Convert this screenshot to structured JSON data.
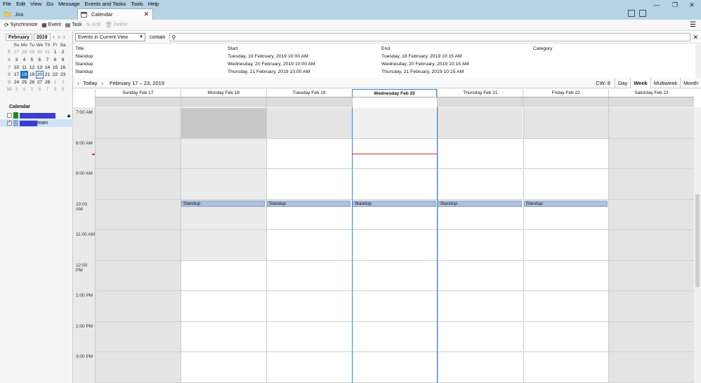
{
  "menu": [
    "File",
    "Edit",
    "View",
    "Go",
    "Message",
    "Events and Tasks",
    "Tools",
    "Help"
  ],
  "window": {
    "minimize": "—",
    "maximize": "❐",
    "close": "✕"
  },
  "tabs": {
    "jira": "Jira",
    "calendar": "Calendar",
    "close": "✕"
  },
  "toolbar": {
    "synchronize": "Synchronize",
    "event": "Event",
    "task": "Task",
    "edit": "Edit",
    "delete": "Delete",
    "menu_icon": "☰"
  },
  "minical": {
    "month": "February",
    "year": "2019",
    "prev": "‹",
    "today": "○",
    "next": "›",
    "dayheaders": [
      "Su",
      "Mo",
      "Tu",
      "We",
      "Th",
      "Fr",
      "Sa"
    ],
    "weeks": [
      {
        "wk": "5",
        "days": [
          "27",
          "28",
          "29",
          "30",
          "31",
          "1",
          "2"
        ]
      },
      {
        "wk": "6",
        "days": [
          "3",
          "4",
          "5",
          "6",
          "7",
          "8",
          "9"
        ]
      },
      {
        "wk": "7",
        "days": [
          "10",
          "11",
          "12",
          "13",
          "14",
          "15",
          "16"
        ]
      },
      {
        "wk": "8",
        "days": [
          "17",
          "18",
          "19",
          "20",
          "21",
          "22",
          "23"
        ]
      },
      {
        "wk": "9",
        "days": [
          "24",
          "25",
          "26",
          "27",
          "28",
          "1",
          "2"
        ]
      },
      {
        "wk": "10",
        "days": [
          "3",
          "4",
          "5",
          "6",
          "7",
          "8",
          "9"
        ]
      }
    ],
    "today_label": "18",
    "selected_label": "20"
  },
  "calendars": {
    "title": "Calendar",
    "items": [
      {
        "name": "",
        "color": "#1a8a1a",
        "checked": false
      },
      {
        "name": "team",
        "color": "#8fa8d6",
        "checked": true
      }
    ],
    "warn_icon": "▲",
    "check_mark": "✓"
  },
  "search": {
    "filter": "Events in Current View",
    "contain": "contain",
    "placeholder": "",
    "close": "✕"
  },
  "eventlist": {
    "headers": {
      "title": "Title",
      "start": "Start",
      "end": "End",
      "category": "Category"
    },
    "rows": [
      {
        "title": "Standup",
        "start": "Tuesday, 19 February, 2019 10:00 AM",
        "end": "Tuesday, 19 February, 2019 10:15 AM",
        "category": ""
      },
      {
        "title": "Standup",
        "start": "Wednesday, 20 February, 2019 10:00 AM",
        "end": "Wednesday, 20 February, 2019 10:15 AM",
        "category": ""
      },
      {
        "title": "Standup",
        "start": "Thursday, 21 February, 2019 10:00 AM",
        "end": "Thursday, 21 February, 2019 10:15 AM",
        "category": ""
      }
    ]
  },
  "nav": {
    "prev": "‹",
    "today": "Today",
    "next": "›",
    "range": "February 17 – 23, 2019",
    "cw": "CW: 8",
    "views": [
      "Day",
      "Week",
      "Multiweek",
      "Month"
    ],
    "active_view": "Week"
  },
  "days": [
    {
      "label": "Sunday Feb 17",
      "weekend": true
    },
    {
      "label": "Monday Feb 18",
      "weekend": false
    },
    {
      "label": "Tuesday Feb 19",
      "weekend": false
    },
    {
      "label": "Wednesday Feb 20",
      "weekend": false,
      "current": true
    },
    {
      "label": "Thursday Feb 21",
      "weekend": false
    },
    {
      "label": "Friday Feb 22",
      "weekend": false
    },
    {
      "label": "Saturday Feb 23",
      "weekend": true
    }
  ],
  "times": [
    "7:00 AM",
    "8:00 AM",
    "9:00 AM",
    "10:00 AM",
    "11:00 AM",
    "12:00 PM",
    "1:00 PM",
    "2:00 PM",
    "3:00 PM"
  ],
  "events": [
    {
      "day": 1,
      "title": "Standup",
      "start": "10:00 AM"
    },
    {
      "day": 2,
      "title": "Standup",
      "start": "10:00 AM"
    },
    {
      "day": 3,
      "title": "Standup",
      "start": "10:00 AM"
    },
    {
      "day": 4,
      "title": "Standup",
      "start": "10:00 AM"
    },
    {
      "day": 5,
      "title": "Standup",
      "start": "10:00 AM"
    }
  ],
  "now": {
    "day": 3,
    "time": "8:30 AM"
  }
}
